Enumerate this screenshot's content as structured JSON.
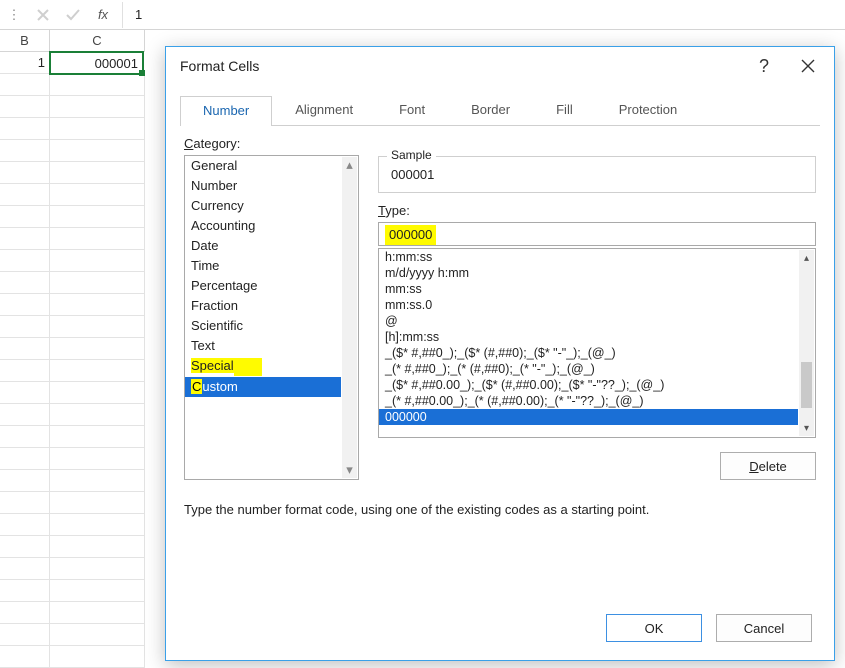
{
  "formula_bar": {
    "fx_label": "fx",
    "value": "1"
  },
  "columns": {
    "B": "B",
    "C": "C"
  },
  "cells": {
    "B1": "1",
    "C1": "000001"
  },
  "dialog": {
    "title": "Format Cells",
    "tabs": [
      "Number",
      "Alignment",
      "Font",
      "Border",
      "Fill",
      "Protection"
    ],
    "category_label": "Category:",
    "categories": [
      "General",
      "Number",
      "Currency",
      "Accounting",
      "Date",
      "Time",
      "Percentage",
      "Fraction",
      "Scientific",
      "Text",
      "Special",
      "Custom"
    ],
    "sample_label": "Sample",
    "sample_value": "000001",
    "type_label": "Type:",
    "type_value": "000000",
    "codes": [
      "h:mm:ss",
      "m/d/yyyy h:mm",
      "mm:ss",
      "mm:ss.0",
      "@",
      "[h]:mm:ss",
      "_($* #,##0_);_($* (#,##0);_($* \"-\"_);_(@_)",
      "_(* #,##0_);_(* (#,##0);_(* \"-\"_);_(@_)",
      "_($* #,##0.00_);_($* (#,##0.00);_($* \"-\"??_);_(@_)",
      "_(* #,##0.00_);_(* (#,##0.00);_(* \"-\"??_);_(@_)",
      "000000"
    ],
    "delete_label": "Delete",
    "help_text": "Type the number format code, using one of the existing codes as a starting point.",
    "ok_label": "OK",
    "cancel_label": "Cancel"
  }
}
